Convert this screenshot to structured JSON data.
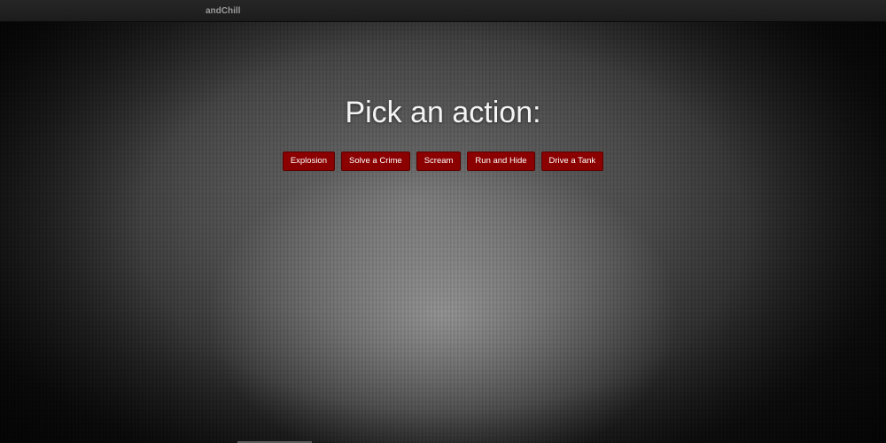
{
  "navbar": {
    "brand": "andChill"
  },
  "main": {
    "title": "Pick an action:",
    "actions": [
      {
        "label": "Explosion"
      },
      {
        "label": "Solve a Crime"
      },
      {
        "label": "Scream"
      },
      {
        "label": "Run and Hide"
      },
      {
        "label": "Drive a Tank"
      }
    ]
  },
  "colors": {
    "navbar": "#1f1f1f",
    "brand_text": "#9a9a9a",
    "button_bg": "#8b0000",
    "button_text": "#ffffff",
    "title_text": "#f4f4f4"
  }
}
